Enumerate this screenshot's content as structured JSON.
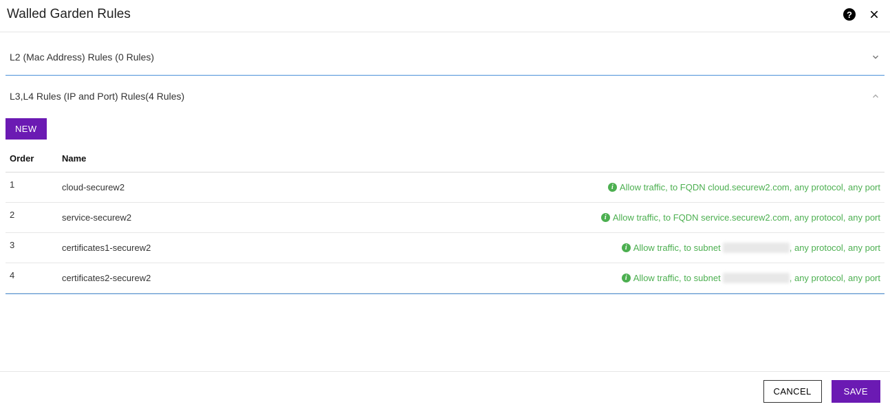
{
  "header": {
    "title": "Walled Garden Rules"
  },
  "sections": {
    "l2": {
      "title": "L2 (Mac Address) Rules (0 Rules)",
      "expanded": false
    },
    "l3l4": {
      "title": "L3,L4 Rules (IP and Port) Rules(4 Rules)",
      "expanded": true,
      "new_label": "NEW",
      "columns": {
        "order": "Order",
        "name": "Name"
      },
      "rows": [
        {
          "order": "1",
          "name": "cloud-securew2",
          "desc_prefix": "Allow traffic, to FQDN cloud.securew2.com, any protocol, any port",
          "has_blur": false
        },
        {
          "order": "2",
          "name": "service-securew2",
          "desc_prefix": "Allow traffic, to FQDN service.securew2.com, any protocol, any port",
          "has_blur": false
        },
        {
          "order": "3",
          "name": "certificates1-securew2",
          "desc_prefix": "Allow traffic, to subnet ",
          "desc_blur": "xxx.xxx.xxx.x/xx",
          "desc_suffix": ", any protocol, any port",
          "has_blur": true
        },
        {
          "order": "4",
          "name": "certificates2-securew2",
          "desc_prefix": "Allow traffic, to subnet ",
          "desc_blur": "xxx.xxx.xxx.x/xx",
          "desc_suffix": ", any protocol, any port",
          "has_blur": true
        }
      ]
    }
  },
  "footer": {
    "cancel_label": "CANCEL",
    "save_label": "SAVE"
  }
}
